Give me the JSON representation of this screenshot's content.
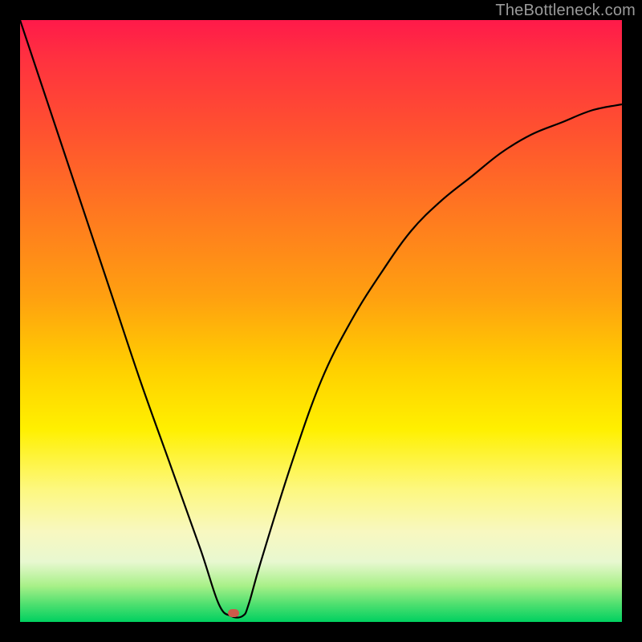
{
  "watermark": "TheBottleneck.com",
  "chart_data": {
    "type": "line",
    "title": "",
    "xlabel": "",
    "ylabel": "",
    "xlim": [
      0,
      100
    ],
    "ylim": [
      0,
      100
    ],
    "gradient_stops": [
      {
        "pos": 0,
        "color": "#ff1a4a"
      },
      {
        "pos": 6,
        "color": "#ff3040"
      },
      {
        "pos": 18,
        "color": "#ff5030"
      },
      {
        "pos": 32,
        "color": "#ff7820"
      },
      {
        "pos": 46,
        "color": "#ffa010"
      },
      {
        "pos": 58,
        "color": "#ffd000"
      },
      {
        "pos": 68,
        "color": "#fff000"
      },
      {
        "pos": 78,
        "color": "#fdf880"
      },
      {
        "pos": 85,
        "color": "#f8f8c0"
      },
      {
        "pos": 90,
        "color": "#e8f8d0"
      },
      {
        "pos": 94,
        "color": "#a8f088"
      },
      {
        "pos": 97,
        "color": "#50e070"
      },
      {
        "pos": 100,
        "color": "#00d060"
      }
    ],
    "series": [
      {
        "name": "bottleneck-curve",
        "x": [
          0,
          5,
          10,
          15,
          20,
          25,
          30,
          33,
          35,
          37,
          38,
          40,
          45,
          50,
          55,
          60,
          65,
          70,
          75,
          80,
          85,
          90,
          95,
          100
        ],
        "y": [
          100,
          85,
          70,
          55,
          40,
          26,
          12,
          3,
          1,
          1,
          3,
          10,
          26,
          40,
          50,
          58,
          65,
          70,
          74,
          78,
          81,
          83,
          85,
          86
        ]
      }
    ],
    "marker": {
      "x": 35.5,
      "y": 1.5,
      "color": "#cc5a4a"
    }
  }
}
